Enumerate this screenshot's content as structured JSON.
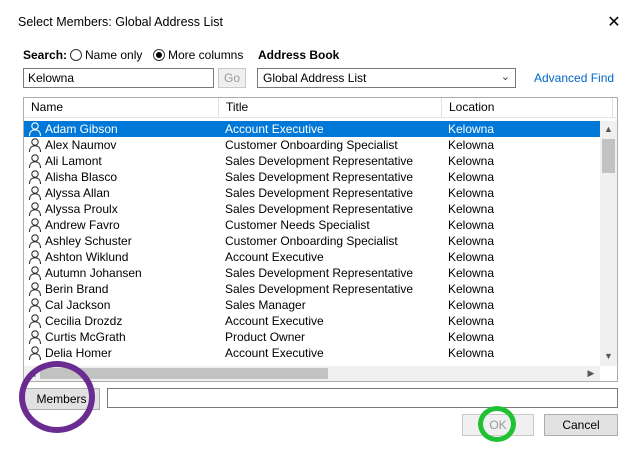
{
  "window": {
    "title": "Select Members: Global Address List"
  },
  "search": {
    "label": "Search:",
    "value": "Kelowna",
    "go_label": "Go",
    "options": [
      {
        "label": "Name only",
        "selected": false
      },
      {
        "label": "More columns",
        "selected": true
      }
    ]
  },
  "address_book": {
    "label": "Address Book",
    "selected": "Global Address List",
    "advanced_find_label": "Advanced Find"
  },
  "table": {
    "columns": [
      "Name",
      "Title",
      "Location"
    ],
    "rows": [
      {
        "name": "Adam Gibson",
        "title": "Account Executive",
        "location": "Kelowna",
        "selected": true
      },
      {
        "name": "Alex Naumov",
        "title": "Customer Onboarding Specialist",
        "location": "Kelowna"
      },
      {
        "name": "Ali Lamont",
        "title": "Sales Development Representative",
        "location": "Kelowna"
      },
      {
        "name": "Alisha Blasco",
        "title": "Sales Development Representative",
        "location": "Kelowna"
      },
      {
        "name": "Alyssa Allan",
        "title": "Sales Development Representative",
        "location": "Kelowna"
      },
      {
        "name": "Alyssa Proulx",
        "title": "Sales Development Representative",
        "location": "Kelowna"
      },
      {
        "name": "Andrew Favro",
        "title": "Customer Needs Specialist",
        "location": "Kelowna"
      },
      {
        "name": "Ashley Schuster",
        "title": "Customer Onboarding Specialist",
        "location": "Kelowna"
      },
      {
        "name": "Ashton Wiklund",
        "title": "Account Executive",
        "location": "Kelowna"
      },
      {
        "name": "Autumn Johansen",
        "title": "Sales Development Representative",
        "location": "Kelowna"
      },
      {
        "name": "Berin Brand",
        "title": "Sales Development Representative",
        "location": "Kelowna"
      },
      {
        "name": "Cal Jackson",
        "title": "Sales Manager",
        "location": "Kelowna"
      },
      {
        "name": "Cecilia Drozdz",
        "title": "Account Executive",
        "location": "Kelowna"
      },
      {
        "name": "Curtis McGrath",
        "title": "Product Owner",
        "location": "Kelowna"
      },
      {
        "name": "Delia Homer",
        "title": "Account Executive",
        "location": "Kelowna"
      }
    ]
  },
  "members": {
    "button_label": "Members",
    "value": ""
  },
  "buttons": {
    "ok": "OK",
    "cancel": "Cancel"
  },
  "colors": {
    "selection": "#0078d7",
    "link": "#0066cc",
    "highlight_members": "#6a2c91",
    "highlight_ok": "#1fc234"
  }
}
